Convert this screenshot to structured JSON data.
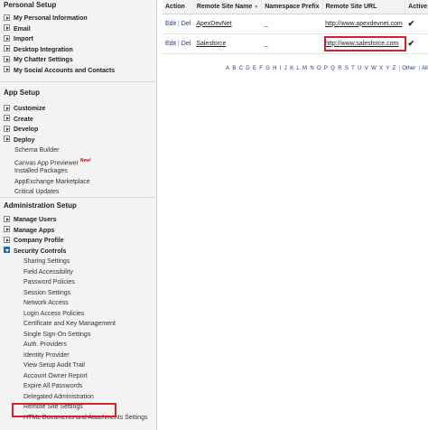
{
  "sidebar": {
    "personal_setup": {
      "title": "Personal Setup",
      "items": [
        {
          "label": "My Personal Information"
        },
        {
          "label": "Email"
        },
        {
          "label": "Import"
        },
        {
          "label": "Desktop Integration"
        },
        {
          "label": "My Chatter Settings"
        },
        {
          "label": "My Social Accounts and Contacts"
        }
      ]
    },
    "app_setup": {
      "title": "App Setup",
      "items": [
        {
          "label": "Customize"
        },
        {
          "label": "Create"
        },
        {
          "label": "Develop"
        },
        {
          "label": "Deploy"
        }
      ],
      "links": [
        {
          "label": "Schema Builder"
        },
        {
          "label": "Canvas App Previewer",
          "badge": "New!"
        },
        {
          "label": "Installed Packages"
        },
        {
          "label": "AppExchange Marketplace"
        },
        {
          "label": "Critical Updates"
        }
      ]
    },
    "admin_setup": {
      "title": "Administration Setup",
      "items": [
        {
          "label": "Manage Users"
        },
        {
          "label": "Manage Apps"
        },
        {
          "label": "Company Profile"
        },
        {
          "label": "Security Controls"
        }
      ],
      "security_children": [
        {
          "label": "Sharing Settings"
        },
        {
          "label": "Field Accessibility"
        },
        {
          "label": "Password Policies"
        },
        {
          "label": "Session Settings"
        },
        {
          "label": "Network Access"
        },
        {
          "label": "Login Access Policies"
        },
        {
          "label": "Certificate and Key Management"
        },
        {
          "label": "Single Sign-On Settings"
        },
        {
          "label": "Auth. Providers"
        },
        {
          "label": "Identity Provider"
        },
        {
          "label": "View Setup Audit Trail"
        },
        {
          "label": "Account Owner Report"
        },
        {
          "label": "Expire All Passwords"
        },
        {
          "label": "Delegated Administration"
        },
        {
          "label": "Remote Site Settings"
        },
        {
          "label": "HTML Documents and Attachments Settings"
        }
      ]
    }
  },
  "table": {
    "headers": {
      "action": "Action",
      "name": "Remote Site Name",
      "name_sort": "▼",
      "prefix": "Namespace Prefix",
      "url": "Remote Site URL",
      "active": "Active"
    },
    "rows": [
      {
        "edit": "Edit",
        "sep": "|",
        "del": "Del",
        "name": "ApexDevNet",
        "prefix": "_",
        "url": "http://www.apexdevnet.com",
        "active": "✔"
      },
      {
        "edit": "Edit",
        "sep": "|",
        "del": "Del",
        "name": "Salesforce",
        "prefix": "_",
        "url": "http://www.salesforce.com",
        "active": "✔"
      }
    ]
  },
  "alphabet": [
    "A",
    "B",
    "C",
    "D",
    "E",
    "F",
    "G",
    "H",
    "I",
    "J",
    "K",
    "L",
    "M",
    "N",
    "O",
    "P",
    "Q",
    "R",
    "S",
    "T",
    "U",
    "V",
    "W",
    "X",
    "Y",
    "Z",
    "Other",
    "All"
  ],
  "colors": {
    "highlight": "#d6212b",
    "link": "#1a3a8a",
    "expanded_twisty": "#1f6db0"
  }
}
